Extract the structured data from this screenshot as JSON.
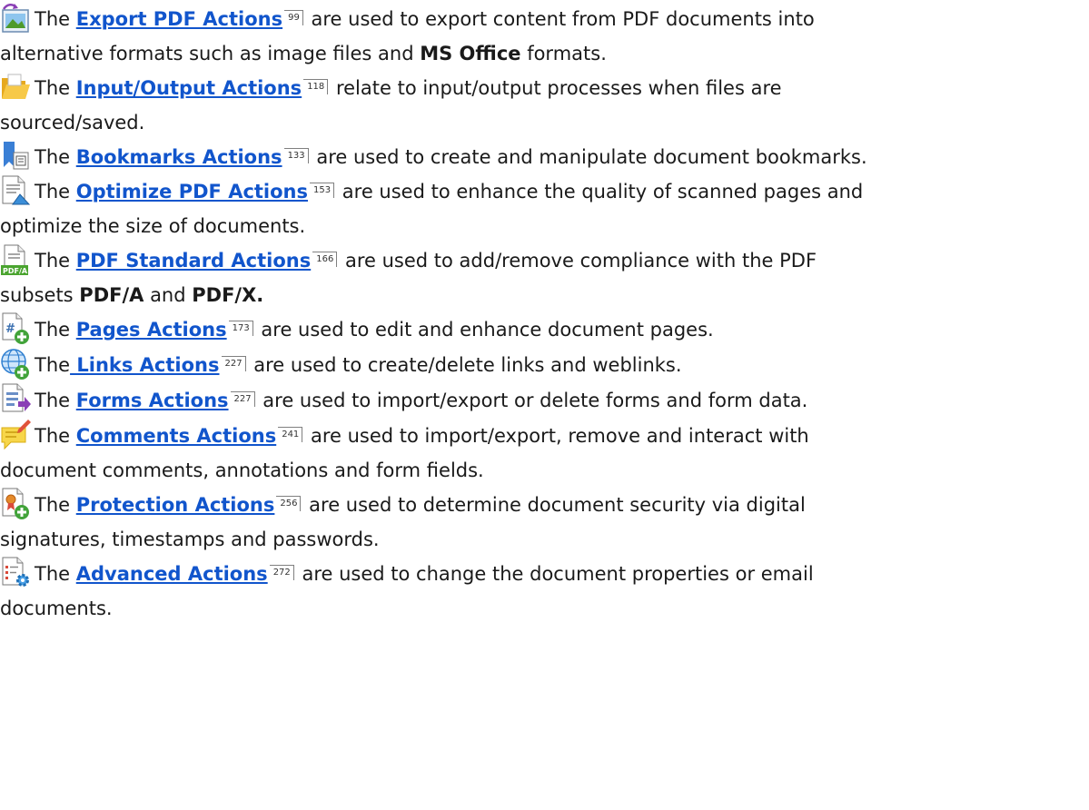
{
  "items": [
    {
      "icon": "export-image-icon",
      "prefix": "The ",
      "link": "Export PDF Actions",
      "page": "99",
      "line1_after": " are used to export content from PDF documents into",
      "line2_a": "alternative formats such as image files and ",
      "line2_b": "MS Office",
      "line2_c": " formats."
    },
    {
      "icon": "folder-icon",
      "prefix": "The ",
      "link": "Input/Output Actions",
      "page": "118",
      "line1_after": " relate to input/output processes when files are",
      "line2_a": "sourced/saved."
    },
    {
      "icon": "bookmark-icon",
      "prefix": "The ",
      "link": "Bookmarks Actions",
      "page": "133",
      "line1_after": " are used to create and manipulate document bookmarks."
    },
    {
      "icon": "optimize-page-icon",
      "prefix": "The ",
      "link": "Optimize PDF Actions",
      "page": "153",
      "line1_after": " are used to enhance the quality of scanned pages and",
      "line2_a": "optimize the size of documents."
    },
    {
      "icon": "pdfa-document-icon",
      "prefix": "The ",
      "link": "PDF Standard Actions",
      "page": "166",
      "line1_after": " are used to add/remove compliance with the PDF",
      "line2_a": "subsets ",
      "line2_b": "PDF/A",
      "line2_c": " and ",
      "line2_d": "PDF/X."
    },
    {
      "icon": "page-number-add-icon",
      "prefix": "The ",
      "link": "Pages Actions",
      "page": "173",
      "line1_after": " are used to edit and enhance document pages."
    },
    {
      "icon": "globe-link-add-icon",
      "prefix": "The",
      "link": " Links Actions",
      "page": "227",
      "line1_after": " are used to create/delete links and weblinks."
    },
    {
      "icon": "form-export-icon",
      "prefix": "The ",
      "link": "Forms Actions",
      "page": "227",
      "line1_after": " are used to import/export or delete forms and form data."
    },
    {
      "icon": "comment-note-icon",
      "prefix": "The ",
      "link": "Comments Actions",
      "page": "241",
      "line1_after": " are used to import/export, remove and interact with",
      "line2_a": "document comments, annotations and form fields."
    },
    {
      "icon": "certificate-add-icon",
      "prefix": "The ",
      "link": "Protection Actions",
      "page": "256",
      "line1_after": " are used to determine document security via digital",
      "line2_a": "signatures, timestamps and passwords."
    },
    {
      "icon": "document-settings-icon",
      "prefix": "The ",
      "link": "Advanced Actions",
      "page": "272",
      "line1_after": " are used to change the document properties or email",
      "line2_a": "documents."
    }
  ]
}
